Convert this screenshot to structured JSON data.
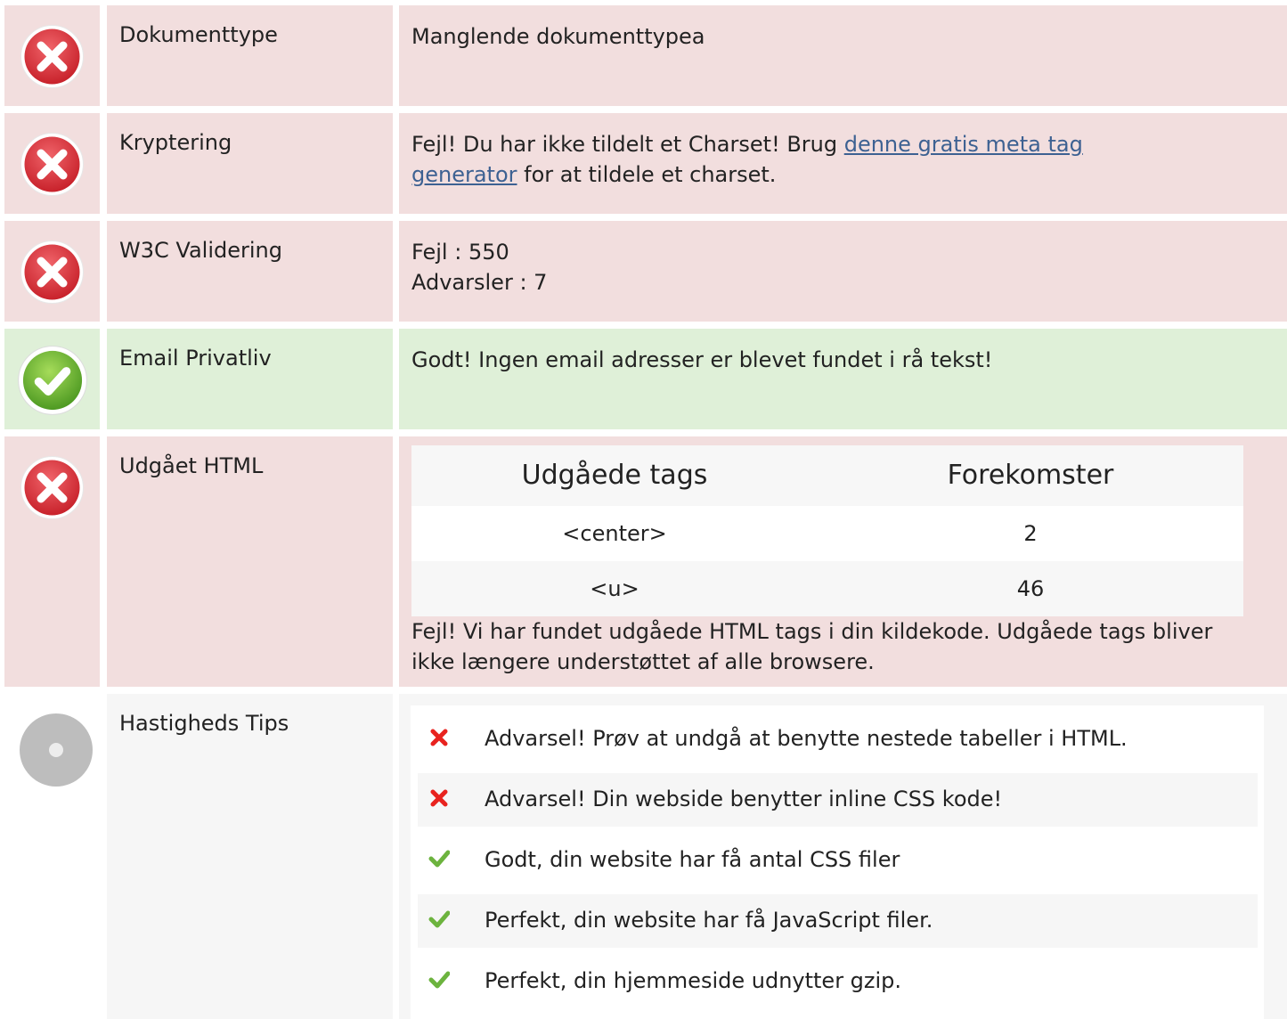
{
  "rows": [
    {
      "label": "Dokumenttype",
      "status": "error",
      "value": "Manglende dokumenttypea"
    },
    {
      "label": "Kryptering",
      "status": "error",
      "value_prefix": "Fejl! Du har ikke tildelt et Charset! Brug ",
      "link_text": "denne gratis meta tag generator",
      "value_suffix": " for at tildele et charset."
    },
    {
      "label": "W3C Validering",
      "status": "error",
      "line1": "Fejl : 550",
      "line2": "Advarsler : 7"
    },
    {
      "label": "Email Privatliv",
      "status": "ok",
      "value": "Godt! Ingen email adresser er blevet fundet i rå tekst!"
    },
    {
      "label": "Udgået HTML",
      "status": "error",
      "table": {
        "headers": [
          "Udgåede tags",
          "Forekomster"
        ],
        "rows": [
          [
            "<center>",
            "2"
          ],
          [
            "<u>",
            "46"
          ]
        ]
      },
      "note": "Fejl! Vi har fundet udgåede HTML tags i din kildekode. Udgåede tags bliver ikke længere understøttet af alle browsere."
    },
    {
      "label": "Hastigheds Tips",
      "status": "info",
      "tips": [
        {
          "status": "warning",
          "text": "Advarsel! Prøv at undgå at benytte nestede tabeller i HTML."
        },
        {
          "status": "warning",
          "text": "Advarsel! Din webside benytter inline CSS kode!"
        },
        {
          "status": "ok",
          "text": "Godt, din website har få antal CSS filer"
        },
        {
          "status": "ok",
          "text": "Perfekt, din website har få JavaScript filer."
        },
        {
          "status": "ok",
          "text": "Perfekt, din hjemmeside udnytter gzip."
        }
      ]
    }
  ],
  "icons": {
    "error": "error-x-circle-icon",
    "ok": "check-circle-icon",
    "info": "gray-circle-icon",
    "tip_warning": "red-x-icon",
    "tip_ok": "green-check-icon"
  },
  "colors": {
    "error_bg": "#f2dede",
    "ok_bg": "#dff0d8",
    "neutral_bg": "#f6f6f6",
    "error_icon": "#d9363e",
    "ok_icon": "#6cb33e",
    "link": "#3d6192"
  }
}
